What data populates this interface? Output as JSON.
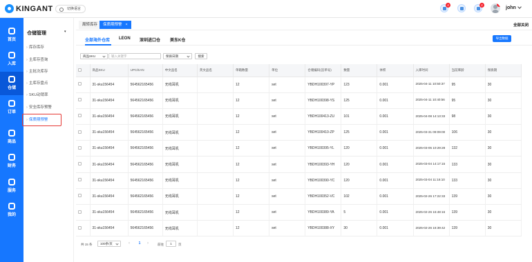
{
  "app": {
    "brand": "KINGANT",
    "language_button": "切换语言",
    "username": "john"
  },
  "header_icons": [
    {
      "name": "bell-icon",
      "badge": "4"
    },
    {
      "name": "chat-icon",
      "badge": ""
    },
    {
      "name": "service-icon",
      "badge": "2"
    }
  ],
  "avatar_badge": "1",
  "left_nav": [
    {
      "label": "首页",
      "icon": "palette-icon"
    },
    {
      "label": "入库",
      "icon": "inbound-icon"
    },
    {
      "label": "仓储",
      "icon": "warehouse-icon"
    },
    {
      "label": "订单",
      "icon": "order-icon"
    },
    {
      "label": "商品",
      "icon": "goods-icon"
    },
    {
      "label": "财务",
      "icon": "finance-icon"
    },
    {
      "label": "服务",
      "icon": "service-icon"
    },
    {
      "label": "我的",
      "icon": "user-icon"
    }
  ],
  "submenu": {
    "title": "仓储管理",
    "items": [
      "库存库存",
      "主库存查询",
      "主批次库存",
      "主库存盘点",
      "SKU动销率",
      "安全库存预警",
      "保质期预警"
    ]
  },
  "tabs": {
    "items": [
      "周转库存",
      "保质期预警"
    ],
    "close_all": "全部关闭"
  },
  "warehouse_tabs": [
    "全部海外仓库",
    "LEON",
    "深圳进口仓",
    "美东K仓"
  ],
  "export_label": "导出数据",
  "filters": {
    "field_select": "商品SKU",
    "keyword_placeholder": "输入关键字",
    "date_select": "保质日期",
    "search_label": "搜索"
  },
  "table": {
    "headers": [
      "商品SKU",
      "UPC/EAN",
      "中文品名",
      "英文品名",
      "单箱数量",
      "单位",
      "仓储编码(追单号)",
      "数量",
      "体积",
      "入库时间",
      "当前库龄",
      "保质期"
    ],
    "rows": [
      [
        "31-sku156454",
        "564562165456",
        "无线耳机",
        "",
        "12",
        "set",
        "YBDH100397-YP",
        "123",
        "0.001",
        "2025-04-11 10:50:37",
        "95",
        "30"
      ],
      [
        "31-sku156454",
        "564562165456",
        "无线耳机",
        "",
        "12",
        "set",
        "YBDH100398-YS",
        "125",
        "0.001",
        "2025-04-11 10:40:56",
        "95",
        "30"
      ],
      [
        "31-sku156454",
        "564562165456",
        "无线耳机",
        "",
        "12",
        "set",
        "YBDH100413-ZU",
        "101",
        "0.001",
        "2025-04-08 14:13:33",
        "98",
        "30"
      ],
      [
        "31-sku156454",
        "564562165456",
        "无线耳机",
        "",
        "12",
        "set",
        "YBDH100410-ZP",
        "125",
        "0.001",
        "2025-03-31 09:09:00",
        "106",
        "30"
      ],
      [
        "31-sku156454",
        "564562165456",
        "无线耳机",
        "",
        "12",
        "set",
        "YBDH100395-YL",
        "120",
        "0.001",
        "2025-03-05 10:29:28",
        "132",
        "30"
      ],
      [
        "31-sku156454",
        "564562165456",
        "无线耳机",
        "",
        "12",
        "set",
        "YBDH100393-YH",
        "120",
        "0.001",
        "2025-03-04 14:17:15",
        "133",
        "30"
      ],
      [
        "31-sku156454",
        "564562165456",
        "无线耳机",
        "",
        "12",
        "set",
        "YBDH100390-YC",
        "120",
        "0.001",
        "2025-03-04 11:16:10",
        "133",
        "30"
      ],
      [
        "31-sku156454",
        "564562165456",
        "无线耳机",
        "",
        "12",
        "set",
        "YBDH100352-VC",
        "102",
        "0.001",
        "2025-02-26 17:22:33",
        "139",
        "30"
      ],
      [
        "31-sku156454",
        "564562165456",
        "无线耳机",
        "",
        "12",
        "set",
        "YBDH100389-YA",
        "5",
        "0.001",
        "2025-02-26 16:48:16",
        "139",
        "30"
      ],
      [
        "31-sku156454",
        "564562165456",
        "无线耳机",
        "",
        "12",
        "set",
        "YBDH100388-XY",
        "30",
        "0.001",
        "2025-02-26 16:39:42",
        "139",
        "30"
      ]
    ]
  },
  "pagination": {
    "total": "共 15 条",
    "page_size": "100条/页",
    "current": "1",
    "goto_label": "前往",
    "goto_value": "1",
    "page_suffix": "页"
  }
}
